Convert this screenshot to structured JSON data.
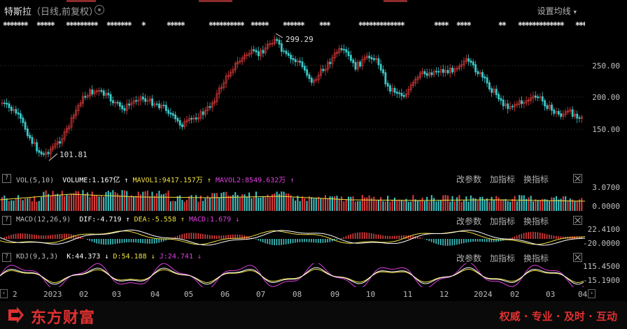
{
  "header": {
    "stock_name": "特斯拉",
    "chart_mode": "（日线,前复权）",
    "ma_setting_label": "设置均线"
  },
  "price_axis": [
    "250.00",
    "200.00",
    "150.00"
  ],
  "annotations": {
    "high": "299.29",
    "low": "101.81"
  },
  "volume_panel": {
    "name": "VOL(5,10)",
    "volume": "VOLUME:1.167亿",
    "mavol1": "MAVOL1:9417.157万",
    "mavol2": "MAVOL2:8549.632万",
    "axis": [
      "3.0700",
      "0.0000"
    ]
  },
  "macd_panel": {
    "name": "MACD(12,26,9)",
    "dif": "DIF:-4.719",
    "dea": "DEA:-5.558",
    "macd": "MACD:1.679",
    "axis": [
      "22.4100",
      "-20.0000"
    ]
  },
  "kdj_panel": {
    "name": "KDJ(9,3,3)",
    "k": "K:44.373",
    "d": "D:54.188",
    "j": "J:24.741",
    "axis": [
      "115.4500",
      "-15.1900"
    ]
  },
  "panel_tools": {
    "params": "改参数",
    "add_indicator": "加指标",
    "swap_indicator": "换指标"
  },
  "date_axis": [
    "2",
    "2023",
    "02",
    "03",
    "04",
    "05",
    "06",
    "07",
    "08",
    "09",
    "10",
    "11",
    "12",
    "2024",
    "02",
    "03",
    "04"
  ],
  "footer": {
    "brand": "东方财富",
    "slogan": "权威 · 专业 · 及时 · 互动"
  },
  "colors": {
    "up": "#e03c3c",
    "down": "#3cc8c8",
    "dif": "#ffffff",
    "dea": "#f0e040",
    "macd": "#e040e0",
    "brand": "#e23030"
  }
}
